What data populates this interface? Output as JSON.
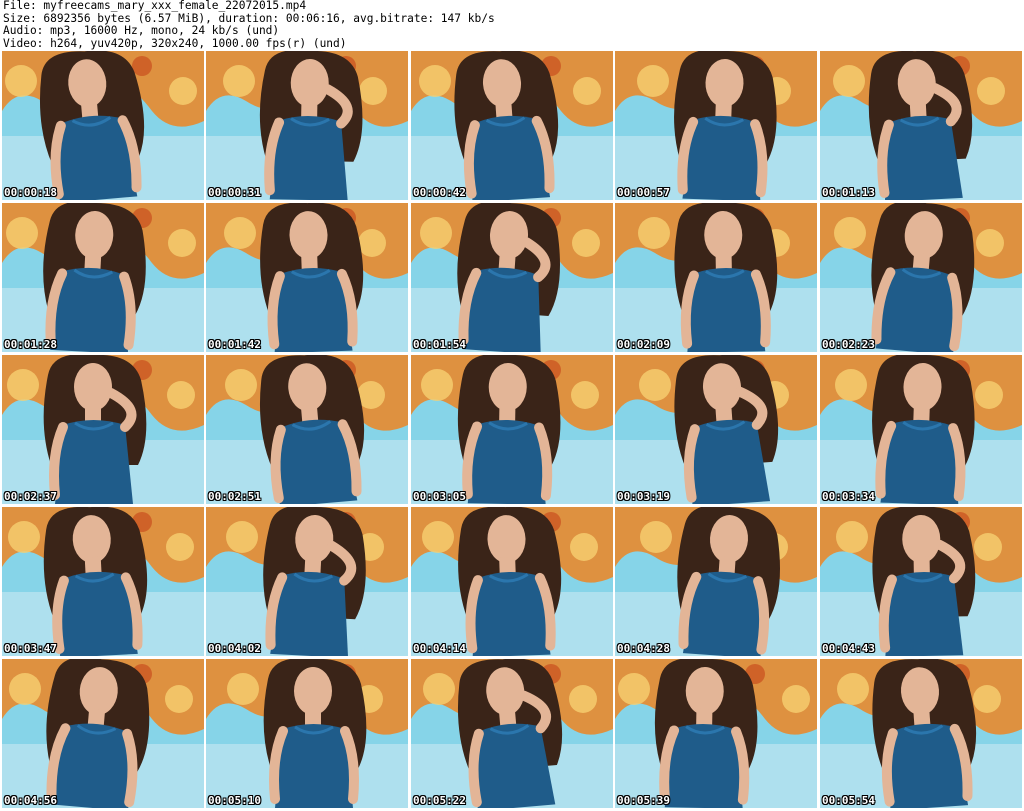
{
  "header": {
    "file": "File: myfreecams_mary_xxx_female_22072015.mp4",
    "size": "Size: 6892356 bytes (6.57 MiB), duration: 00:06:16, avg.bitrate: 147 kb/s",
    "audio": "Audio: mp3, 16000 Hz, mono, 24 kb/s (und)",
    "video": "Video: h264, yuv420p, 320x240, 1000.00 fps(r) (und)"
  },
  "colors": {
    "wall_blue": "#86d4e8",
    "wall_orange": "#e88a2e",
    "dress_blue": "#1f5c8a",
    "hair_brown": "#3a2418",
    "skin": "#e3b597"
  },
  "thumbnails": [
    {
      "timestamp": "00:00:18"
    },
    {
      "timestamp": "00:00:31"
    },
    {
      "timestamp": "00:00:42"
    },
    {
      "timestamp": "00:00:57"
    },
    {
      "timestamp": "00:01:13"
    },
    {
      "timestamp": "00:01:28"
    },
    {
      "timestamp": "00:01:42"
    },
    {
      "timestamp": "00:01:54"
    },
    {
      "timestamp": "00:02:09"
    },
    {
      "timestamp": "00:02:23"
    },
    {
      "timestamp": "00:02:37"
    },
    {
      "timestamp": "00:02:51"
    },
    {
      "timestamp": "00:03:05"
    },
    {
      "timestamp": "00:03:19"
    },
    {
      "timestamp": "00:03:34"
    },
    {
      "timestamp": "00:03:47"
    },
    {
      "timestamp": "00:04:02"
    },
    {
      "timestamp": "00:04:14"
    },
    {
      "timestamp": "00:04:28"
    },
    {
      "timestamp": "00:04:43"
    },
    {
      "timestamp": "00:04:56"
    },
    {
      "timestamp": "00:05:10"
    },
    {
      "timestamp": "00:05:22"
    },
    {
      "timestamp": "00:05:39"
    },
    {
      "timestamp": "00:05:54"
    }
  ]
}
